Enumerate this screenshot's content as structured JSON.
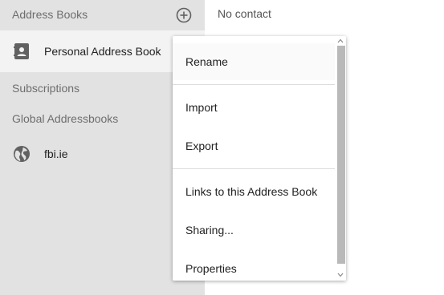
{
  "sidebar": {
    "address_books_header": "Address Books",
    "subscriptions_header": "Subscriptions",
    "global_header": "Global Addressbooks",
    "books": [
      {
        "label": "Personal Address Book",
        "icon": "contact-card-icon",
        "selected": true
      },
      {
        "label": "fbi.ie",
        "icon": "globe-icon",
        "selected": false
      }
    ]
  },
  "main": {
    "empty_text": "No contact"
  },
  "context_menu": {
    "items": [
      {
        "label": "Rename"
      },
      {
        "label": "Import"
      },
      {
        "label": "Export"
      },
      {
        "label": "Links to this Address Book"
      },
      {
        "label": "Sharing..."
      },
      {
        "label": "Properties"
      }
    ]
  },
  "colors": {
    "sidebar_bg": "#e2e2e2",
    "selected_bg": "#f3f3f3",
    "icon_color": "#616161",
    "scroll_thumb": "#b9b9b9"
  }
}
